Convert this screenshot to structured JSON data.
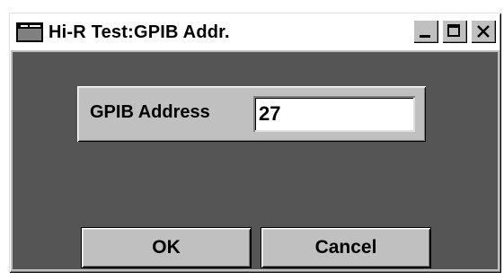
{
  "window": {
    "title": "Hi-R Test:GPIB Addr.",
    "system_icon": "app-window-icon",
    "caption_buttons": {
      "minimize": "minimize-icon",
      "maximize": "maximize-icon",
      "close": "close-icon"
    }
  },
  "form": {
    "address_label": "GPIB Address",
    "address_value": "27"
  },
  "buttons": {
    "ok_label": "OK",
    "cancel_label": "Cancel"
  },
  "colors": {
    "client_background": "#555555",
    "control_face": "#c0c0c0",
    "title_background": "#ffffff"
  }
}
